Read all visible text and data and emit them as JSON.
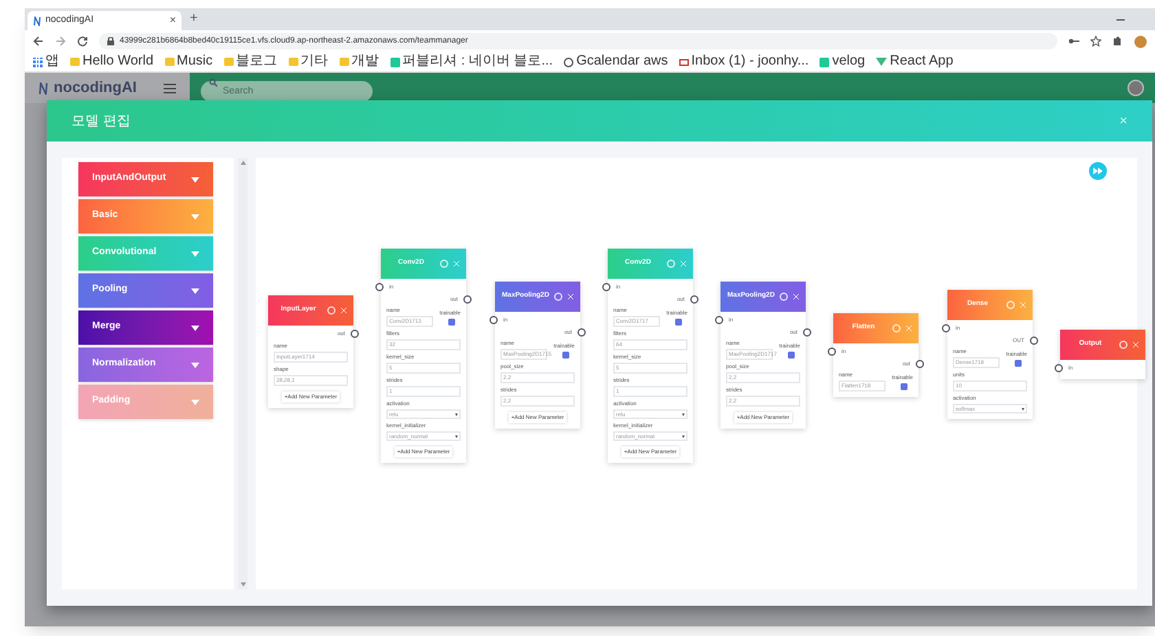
{
  "browser": {
    "tab_title": "nocodingAI",
    "tab_close": "×",
    "new_tab": "+",
    "url": "43999c281b6864b8bed40c19115ce1.vfs.cloud9.ap-northeast-2.amazonaws.com/teammanager",
    "bookmarks": [
      {
        "label": "앱",
        "kind": "apps"
      },
      {
        "label": "Hello World",
        "kind": "folder"
      },
      {
        "label": "Music",
        "kind": "folder"
      },
      {
        "label": "블로그",
        "kind": "folder"
      },
      {
        "label": "기타",
        "kind": "folder"
      },
      {
        "label": "개발",
        "kind": "folder"
      },
      {
        "label": "퍼블리셔 : 네이버 블로...",
        "kind": "site"
      },
      {
        "label": "Gcalendar aws",
        "kind": "globe"
      },
      {
        "label": "Inbox (1) - joonhy...",
        "kind": "mail"
      },
      {
        "label": "velog",
        "kind": "site"
      },
      {
        "label": "React App",
        "kind": "vue"
      }
    ]
  },
  "app": {
    "brand": "nocodingAI",
    "search": {
      "placeholder": "Search"
    }
  },
  "modal": {
    "title": "모델 편집",
    "close": "×",
    "categories": [
      {
        "label": "InputAndOutput",
        "kind": "io"
      },
      {
        "label": "Basic",
        "kind": "basic"
      },
      {
        "label": "Convolutional",
        "kind": "conv"
      },
      {
        "label": "Pooling",
        "kind": "pool"
      },
      {
        "label": "Merge",
        "kind": "merge"
      },
      {
        "label": "Normalization",
        "kind": "norm"
      },
      {
        "label": "Padding",
        "kind": "pad"
      }
    ],
    "nodes": [
      {
        "title": "InputLayer",
        "kind": "io",
        "out_label": "out",
        "fields": [
          {
            "kind": "text",
            "label": "name",
            "value": "InputLayer1714"
          },
          {
            "kind": "text",
            "label": "shape",
            "value": "28,28,1"
          }
        ],
        "add_button": "+Add New Parameter"
      },
      {
        "title": "Conv2D",
        "kind": "conv",
        "in_label": "in",
        "out_label": "out",
        "fields": [
          {
            "kind": "name",
            "label": "name",
            "value": "Conv2D1713",
            "trainable_label": "trainable",
            "checked": true
          },
          {
            "kind": "text",
            "label": "filters",
            "value": "32"
          },
          {
            "kind": "text",
            "label": "kernel_size",
            "value": "5"
          },
          {
            "kind": "text",
            "label": "strides",
            "value": "1"
          },
          {
            "kind": "select",
            "label": "activation",
            "value": "relu"
          },
          {
            "kind": "select",
            "label": "kernel_initializer",
            "value": "random_normal"
          }
        ],
        "add_button": "+Add New Parameter"
      },
      {
        "title": "MaxPooling2D",
        "kind": "pool",
        "in_label": "in",
        "out_label": "out",
        "fields": [
          {
            "kind": "name",
            "label": "name",
            "value": "MaxPooling2D1715",
            "trainable_label": "trainable",
            "checked": true
          },
          {
            "kind": "text",
            "label": "pool_size",
            "value": "2,2"
          },
          {
            "kind": "text",
            "label": "strides",
            "value": "2,2"
          }
        ],
        "add_button": "+Add New Parameter"
      },
      {
        "title": "Conv2D",
        "kind": "conv",
        "in_label": "in",
        "out_label": "out",
        "fields": [
          {
            "kind": "name",
            "label": "name",
            "value": "Conv2D1717",
            "trainable_label": "trainable",
            "checked": true
          },
          {
            "kind": "text",
            "label": "filters",
            "value": "64"
          },
          {
            "kind": "text",
            "label": "kernel_size",
            "value": "5"
          },
          {
            "kind": "text",
            "label": "strides",
            "value": "1"
          },
          {
            "kind": "select",
            "label": "activation",
            "value": "relu"
          },
          {
            "kind": "select",
            "label": "kernel_initializer",
            "value": "random_normal"
          }
        ],
        "add_button": "+Add New Parameter"
      },
      {
        "title": "MaxPooling2D",
        "kind": "pool",
        "in_label": "in",
        "out_label": "out",
        "fields": [
          {
            "kind": "name",
            "label": "name",
            "value": "MaxPooling2D1717",
            "trainable_label": "trainable",
            "checked": true
          },
          {
            "kind": "text",
            "label": "pool_size",
            "value": "2,2"
          },
          {
            "kind": "text",
            "label": "strides",
            "value": "2,2"
          }
        ],
        "add_button": "+Add New Parameter"
      },
      {
        "title": "Flatten",
        "kind": "basic",
        "in_label": "in",
        "out_label": "out",
        "fields": [
          {
            "kind": "name",
            "label": "name",
            "value": "Flatten1718",
            "trainable_label": "trainable",
            "checked": true
          }
        ]
      },
      {
        "title": "Dense",
        "kind": "basic",
        "in_label": "in",
        "out_label": "OUT",
        "fields": [
          {
            "kind": "name",
            "label": "name",
            "value": "Dense1719",
            "trainable_label": "trainable",
            "checked": true
          },
          {
            "kind": "text",
            "label": "units",
            "value": "10"
          },
          {
            "kind": "select",
            "label": "activation",
            "value": "softmax"
          }
        ]
      },
      {
        "title": "Output",
        "kind": "io",
        "in_label": "in"
      }
    ]
  }
}
